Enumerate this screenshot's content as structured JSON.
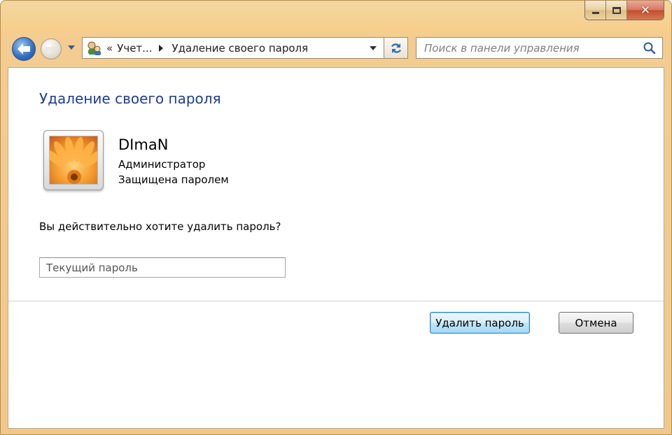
{
  "window": {
    "caption_buttons": {
      "minimize": "minimize",
      "maximize": "maximize",
      "close": "✕"
    }
  },
  "navbar": {
    "breadcrumb": {
      "overflow": "«",
      "segment1": "Учет...",
      "segment2": "Удаление своего пароля"
    },
    "search": {
      "placeholder": "Поиск в панели управления"
    }
  },
  "main": {
    "title": "Удаление своего пароля",
    "user": {
      "name": "DImaN",
      "role": "Администратор",
      "status": "Защищена паролем"
    },
    "question": "Вы действительно хотите удалить пароль?",
    "password_field": {
      "placeholder": "Текущий пароль",
      "value": ""
    },
    "buttons": {
      "remove_password": "Удалить пароль",
      "cancel": "Отмена"
    }
  },
  "colors": {
    "title_text": "#1e3d8f",
    "frame": "#f2cc90",
    "primary_button": "#bee6fd"
  },
  "icons": [
    "back-arrow-icon",
    "forward-arrow-icon",
    "control-panel-icon",
    "refresh-icon",
    "search-icon",
    "user-avatar-flower"
  ]
}
